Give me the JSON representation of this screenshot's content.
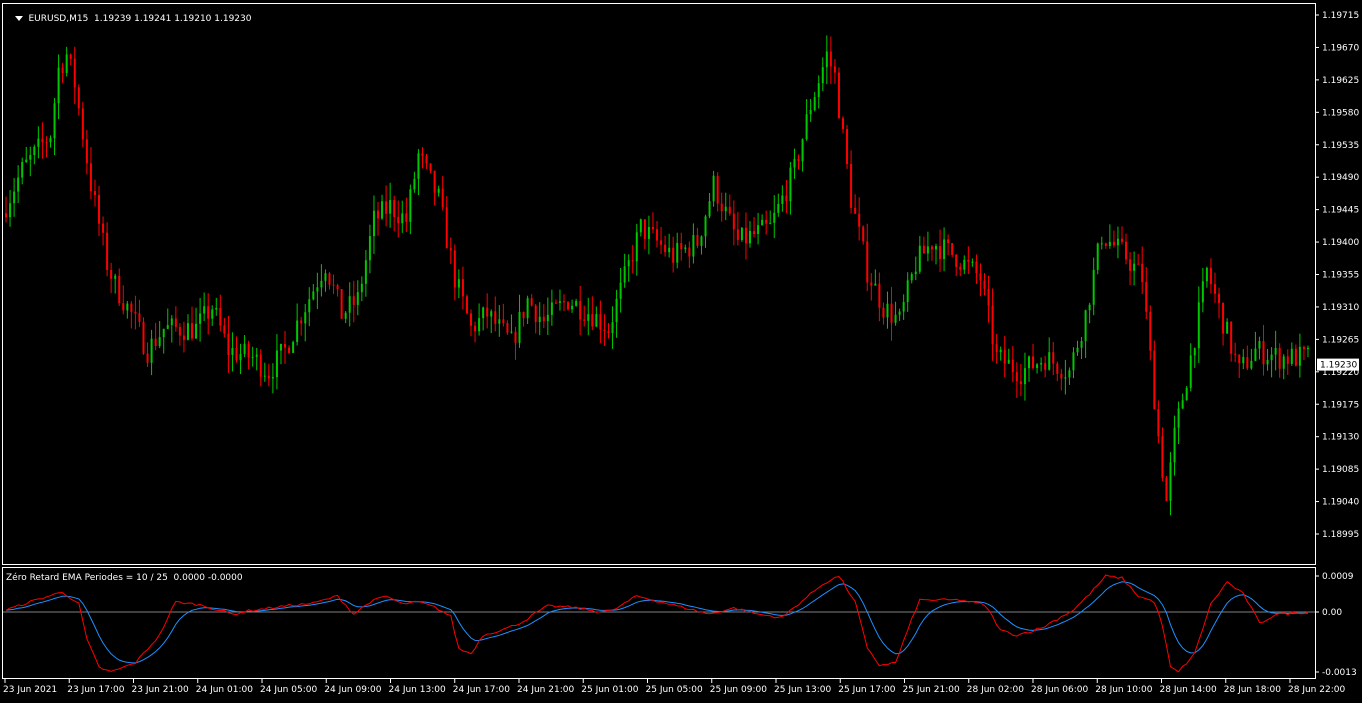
{
  "header": {
    "symbol": "EURUSD,M15",
    "ohlc": "1.19239 1.19241 1.19210 1.19230"
  },
  "indicator": {
    "label": "Zéro Retard EMA Periodes = 10 / 25  0.0000 -0.0000",
    "axis_labels": [
      "0.0009",
      "0.00",
      "-0.0013"
    ],
    "axis_values": [
      0.0009,
      0.0,
      -0.0013
    ],
    "colors": {
      "fast": "#ff0000",
      "slow": "#1e90ff",
      "zero_line": "#808080"
    }
  },
  "price_axis": {
    "labels": [
      "1.19715",
      "1.19670",
      "1.19625",
      "1.19580",
      "1.19535",
      "1.19490",
      "1.19445",
      "1.19400",
      "1.19355",
      "1.19310",
      "1.19265",
      "1.19220",
      "1.19175",
      "1.19130",
      "1.19085",
      "1.19040",
      "1.18995"
    ],
    "values": [
      1.19715,
      1.1967,
      1.19625,
      1.1958,
      1.19535,
      1.1949,
      1.19445,
      1.194,
      1.19355,
      1.1931,
      1.19265,
      1.1922,
      1.19175,
      1.1913,
      1.19085,
      1.1904,
      1.18995
    ],
    "current_price": "1.19230",
    "current_value": 1.1923
  },
  "time_axis": {
    "labels": [
      "23 Jun 2021",
      "23 Jun 17:00",
      "23 Jun 21:00",
      "24 Jun 01:00",
      "24 Jun 05:00",
      "24 Jun 09:00",
      "24 Jun 13:00",
      "24 Jun 17:00",
      "24 Jun 21:00",
      "25 Jun 01:00",
      "25 Jun 05:00",
      "25 Jun 09:00",
      "25 Jun 13:00",
      "25 Jun 17:00",
      "25 Jun 21:00",
      "28 Jun 02:00",
      "28 Jun 06:00",
      "28 Jun 10:00",
      "28 Jun 14:00",
      "28 Jun 18:00",
      "28 Jun 22:00"
    ]
  },
  "colors": {
    "bull": "#00c800",
    "bear": "#ff0000",
    "background": "#000000",
    "frame": "#ffffff"
  },
  "chart_data": {
    "type": "candlestick",
    "price_waypoints": [
      [
        0,
        1.1944
      ],
      [
        5,
        1.195
      ],
      [
        12,
        1.1955
      ],
      [
        14,
        1.1964
      ],
      [
        16,
        1.1966
      ],
      [
        18,
        1.1962
      ],
      [
        22,
        1.1948
      ],
      [
        26,
        1.1937
      ],
      [
        28,
        1.1934
      ],
      [
        32,
        1.193
      ],
      [
        36,
        1.1925
      ],
      [
        40,
        1.1928
      ],
      [
        48,
        1.1928
      ],
      [
        52,
        1.1931
      ],
      [
        56,
        1.1925
      ],
      [
        62,
        1.1924
      ],
      [
        66,
        1.1922
      ],
      [
        70,
        1.1925
      ],
      [
        74,
        1.193
      ],
      [
        80,
        1.1937
      ],
      [
        84,
        1.193
      ],
      [
        88,
        1.1932
      ],
      [
        92,
        1.1943
      ],
      [
        96,
        1.1945
      ],
      [
        100,
        1.1943
      ],
      [
        103,
        1.1952
      ],
      [
        108,
        1.1946
      ],
      [
        112,
        1.1935
      ],
      [
        116,
        1.1928
      ],
      [
        120,
        1.193
      ],
      [
        126,
        1.1926
      ],
      [
        130,
        1.1932
      ],
      [
        134,
        1.1929
      ],
      [
        140,
        1.1932
      ],
      [
        146,
        1.193
      ],
      [
        150,
        1.1928
      ],
      [
        154,
        1.1935
      ],
      [
        158,
        1.1942
      ],
      [
        166,
        1.1938
      ],
      [
        172,
        1.194
      ],
      [
        176,
        1.1948
      ],
      [
        182,
        1.194
      ],
      [
        190,
        1.1942
      ],
      [
        196,
        1.195
      ],
      [
        200,
        1.1959
      ],
      [
        204,
        1.1966
      ],
      [
        206,
        1.1963
      ],
      [
        210,
        1.1946
      ],
      [
        214,
        1.1936
      ],
      [
        218,
        1.1931
      ],
      [
        222,
        1.1929
      ],
      [
        226,
        1.1937
      ],
      [
        230,
        1.194
      ],
      [
        236,
        1.1938
      ],
      [
        242,
        1.1935
      ],
      [
        246,
        1.1924
      ],
      [
        252,
        1.1922
      ],
      [
        258,
        1.1924
      ],
      [
        264,
        1.1922
      ],
      [
        268,
        1.193
      ],
      [
        272,
        1.1941
      ],
      [
        278,
        1.1938
      ],
      [
        282,
        1.1935
      ],
      [
        286,
        1.1913
      ],
      [
        288,
        1.1904
      ],
      [
        290,
        1.1913
      ],
      [
        294,
        1.1924
      ],
      [
        298,
        1.1936
      ],
      [
        302,
        1.1929
      ],
      [
        306,
        1.1922
      ],
      [
        310,
        1.1925
      ],
      [
        316,
        1.1924
      ],
      [
        322,
        1.1924
      ]
    ],
    "indicator_waypoints": [
      [
        0,
        5e-05
      ],
      [
        8,
        0.00032
      ],
      [
        14,
        0.0005
      ],
      [
        18,
        0.0002
      ],
      [
        20,
        -0.0006
      ],
      [
        23,
        -0.0012
      ],
      [
        26,
        -0.0013
      ],
      [
        32,
        -0.0011
      ],
      [
        38,
        -0.0005
      ],
      [
        42,
        0.00025
      ],
      [
        48,
        0.00018
      ],
      [
        56,
        -5e-05
      ],
      [
        60,
        3e-05
      ],
      [
        70,
        0.00016
      ],
      [
        76,
        0.00022
      ],
      [
        82,
        0.0004
      ],
      [
        86,
        -5e-05
      ],
      [
        90,
        0.00025
      ],
      [
        94,
        0.0004
      ],
      [
        98,
        0.0002
      ],
      [
        102,
        0.00025
      ],
      [
        106,
        0.00012
      ],
      [
        110,
        -0.0001
      ],
      [
        112,
        -0.0008
      ],
      [
        115,
        -0.0009
      ],
      [
        118,
        -0.0005
      ],
      [
        124,
        -0.00035
      ],
      [
        128,
        -0.0002
      ],
      [
        134,
        0.00015
      ],
      [
        140,
        0.00012
      ],
      [
        146,
        2e-05
      ],
      [
        150,
        3e-05
      ],
      [
        156,
        0.0004
      ],
      [
        162,
        0.00025
      ],
      [
        168,
        0.0001
      ],
      [
        174,
        -5e-05
      ],
      [
        180,
        0.0001
      ],
      [
        186,
        -5e-05
      ],
      [
        192,
        -0.00012
      ],
      [
        196,
        0.0002
      ],
      [
        202,
        0.0007
      ],
      [
        206,
        0.0009
      ],
      [
        210,
        0.00025
      ],
      [
        213,
        -0.0008
      ],
      [
        216,
        -0.00115
      ],
      [
        220,
        -0.0011
      ],
      [
        226,
        0.0003
      ],
      [
        230,
        0.0003
      ],
      [
        236,
        0.0003
      ],
      [
        242,
        0.00018
      ],
      [
        246,
        -0.0004
      ],
      [
        250,
        -0.0005
      ],
      [
        256,
        -0.00035
      ],
      [
        264,
        5e-05
      ],
      [
        268,
        0.00045
      ],
      [
        272,
        0.0009
      ],
      [
        276,
        0.00085
      ],
      [
        280,
        0.0004
      ],
      [
        284,
        0.00025
      ],
      [
        286,
        -0.0003
      ],
      [
        288,
        -0.0012
      ],
      [
        290,
        -0.0013
      ],
      [
        294,
        -0.0009
      ],
      [
        298,
        0.0002
      ],
      [
        302,
        0.00075
      ],
      [
        306,
        0.00045
      ],
      [
        310,
        -0.00025
      ],
      [
        314,
        -5e-05
      ],
      [
        322,
        0.0
      ]
    ]
  }
}
